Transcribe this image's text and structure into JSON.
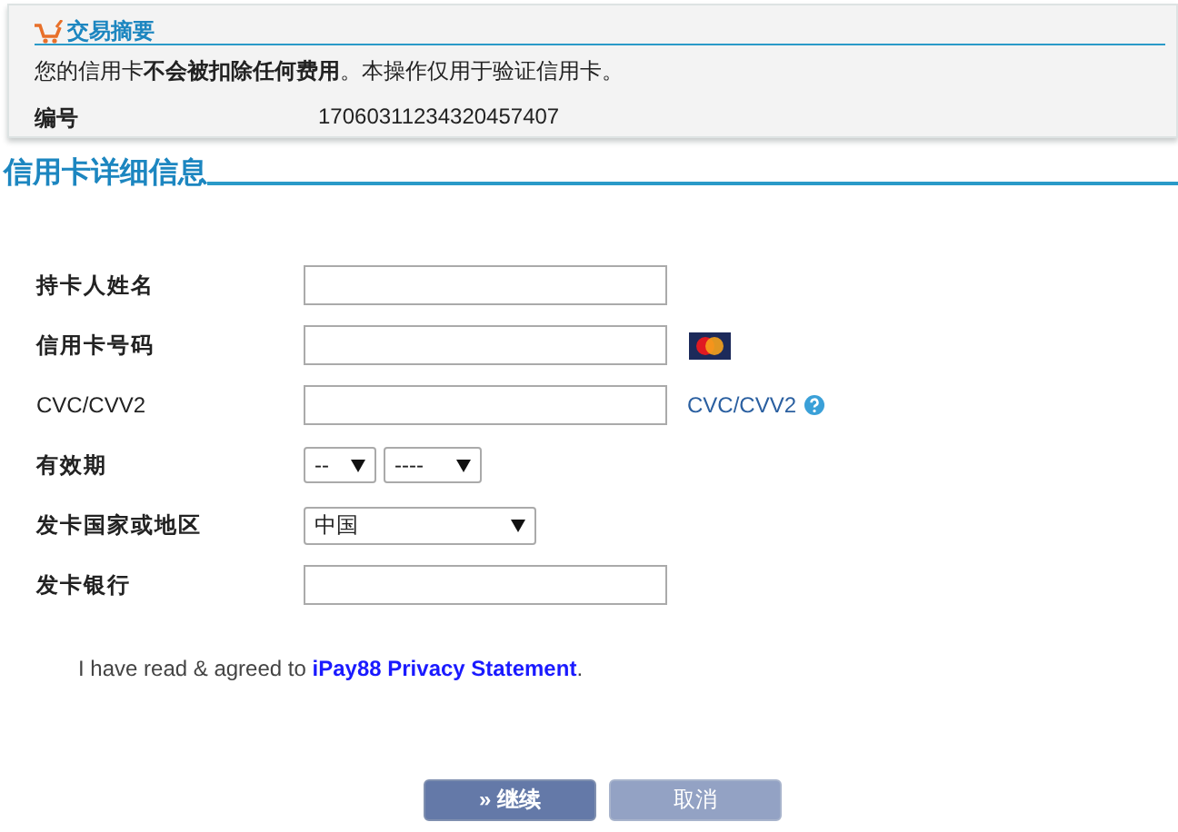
{
  "summary": {
    "title": "交易摘要",
    "notice": "您的信用卡**不会被扣除任何费用**。本操作仅用于验证信用卡。",
    "ref_label": "编号",
    "ref_value": "17060311234320457407"
  },
  "section_title": "信用卡详细信息",
  "fields": [
    {
      "kind": "text",
      "label": "持卡人姓名",
      "bold": true,
      "card_logo": false
    },
    {
      "kind": "text",
      "label": "信用卡号码",
      "bold": true,
      "card_logo": true
    },
    {
      "kind": "text",
      "label": "CVC/CVV2",
      "bold": false,
      "card_logo": false,
      "help": "CVC/CVV2"
    },
    {
      "kind": "expiry",
      "label": "有效期",
      "bold": true,
      "card_logo": false,
      "month": "--",
      "year": "----"
    },
    {
      "kind": "select",
      "label": "发卡国家或地区",
      "bold": true,
      "card_logo": false,
      "value": "中国"
    },
    {
      "kind": "text",
      "label": "发卡银行",
      "bold": true,
      "card_logo": false
    }
  ],
  "agreement": {
    "text": "I have read & agreed to ",
    "link": "iPay88 Privacy Statement",
    "end": "."
  },
  "buttons": [
    {
      "kind": "primary",
      "label": "» 继续"
    },
    {
      "kind": "secondary",
      "label": "取消"
    }
  ]
}
